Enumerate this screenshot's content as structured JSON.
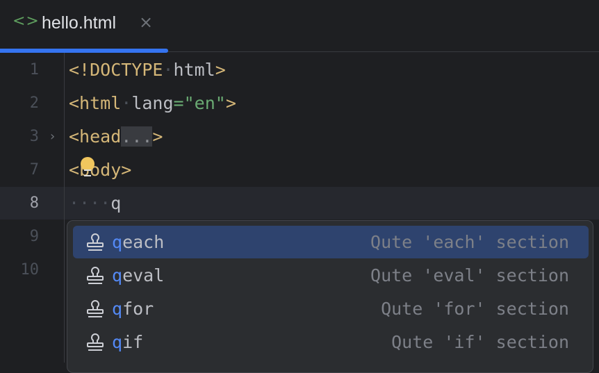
{
  "tab": {
    "icon": "<>",
    "name": "hello.html",
    "close": "×"
  },
  "lines": [
    {
      "num": "1"
    },
    {
      "num": "2"
    },
    {
      "num": "3"
    },
    {
      "num": "7"
    },
    {
      "num": "8"
    },
    {
      "num": "9"
    },
    {
      "num": "10"
    }
  ],
  "code": {
    "l1_tag": "<!DOCTYPE",
    "l1_ws": "·",
    "l1_rest": "html",
    "l1_close": ">",
    "l2_open": "<html",
    "l2_ws": "·",
    "l2_attr": "lang",
    "l2_eq": "=",
    "l2_str": "\"en\"",
    "l2_close": ">",
    "l3_open": "<head",
    "l3_dots": "...",
    "l3_close": ">",
    "l7": "<body>",
    "l8_ws": "····",
    "l8_text": "q"
  },
  "completion": {
    "typed": "q",
    "items": [
      {
        "rest": "each",
        "desc": "Qute 'each' section"
      },
      {
        "rest": "eval",
        "desc": "Qute 'eval' section"
      },
      {
        "rest": "for",
        "desc": "Qute 'for' section"
      },
      {
        "rest": "if",
        "desc": "Qute 'if' section"
      }
    ]
  }
}
